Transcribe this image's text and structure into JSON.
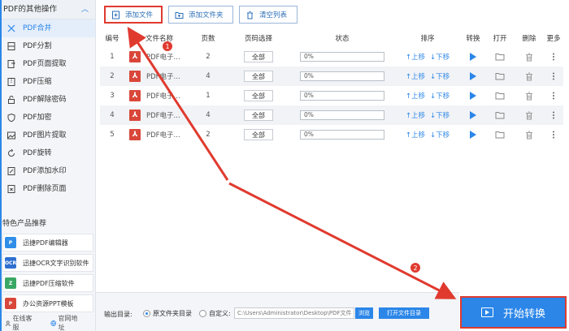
{
  "sidebar": {
    "header": "PDF的其他操作",
    "up_icon": "chevron-up-icon",
    "items": [
      {
        "label": "PDF合并",
        "icon": "merge-icon"
      },
      {
        "label": "PDF分割",
        "icon": "split-icon"
      },
      {
        "label": "PDF页面提取",
        "icon": "page-extract-icon"
      },
      {
        "label": "PDF压缩",
        "icon": "compress-icon"
      },
      {
        "label": "PDF解除密码",
        "icon": "unlock-icon"
      },
      {
        "label": "PDF加密",
        "icon": "shield-icon"
      },
      {
        "label": "PDF图片提取",
        "icon": "image-extract-icon"
      },
      {
        "label": "PDF旋转",
        "icon": "rotate-icon"
      },
      {
        "label": "PDF添加水印",
        "icon": "watermark-icon"
      },
      {
        "label": "PDF删除页面",
        "icon": "delete-page-icon"
      }
    ],
    "feature_title": "特色产品推荐",
    "promos": [
      {
        "label": "迅捷PDF编辑器",
        "icon_text": "P",
        "color": "#2f8ee8"
      },
      {
        "label": "迅捷OCR文字识别软件",
        "icon_text": "OCR",
        "color": "#2f6fd0"
      },
      {
        "label": "迅捷PDF压缩软件",
        "icon_text": "Z",
        "color": "#3aa864"
      },
      {
        "label": "办公资源PPT模板",
        "icon_text": "P",
        "color": "#d9473a"
      }
    ],
    "bottom": {
      "service": "在线客服",
      "website": "官网地址"
    }
  },
  "toolbar": {
    "add_file": "添加文件",
    "add_folder": "添加文件夹",
    "clear_list": "清空列表"
  },
  "table": {
    "headers": [
      "编号",
      "文件名称",
      "页数",
      "页码选择",
      "状态",
      "排序",
      "转换",
      "打开",
      "删除",
      "更多"
    ],
    "rows": [
      {
        "num": "1",
        "name": "PDF电子...",
        "pages": "2",
        "pagesel": "全部",
        "status": "0%"
      },
      {
        "num": "2",
        "name": "PDF电子...",
        "pages": "4",
        "pagesel": "全部",
        "status": "0%"
      },
      {
        "num": "3",
        "name": "PDF电子...",
        "pages": "1",
        "pagesel": "全部",
        "status": "0%"
      },
      {
        "num": "4",
        "name": "PDF电子...",
        "pages": "4",
        "pagesel": "全部",
        "status": "0%"
      },
      {
        "num": "5",
        "name": "PDF电子...",
        "pages": "2",
        "pagesel": "全部",
        "status": "0%"
      }
    ],
    "up_label": "↑上移",
    "down_label": "↓下移"
  },
  "bottom": {
    "output_label": "输出目录:",
    "radio_source": "原文件夹目录",
    "radio_custom": "自定义:",
    "path": "C:\\Users\\Administrator\\Desktop\\PDF文件",
    "browse": "浏览",
    "open_dir": "打开文件目录"
  },
  "start_button": "开始转换",
  "annotations": {
    "marker1": "1",
    "marker2": "2",
    "arrow_color": "#e03a2f"
  }
}
